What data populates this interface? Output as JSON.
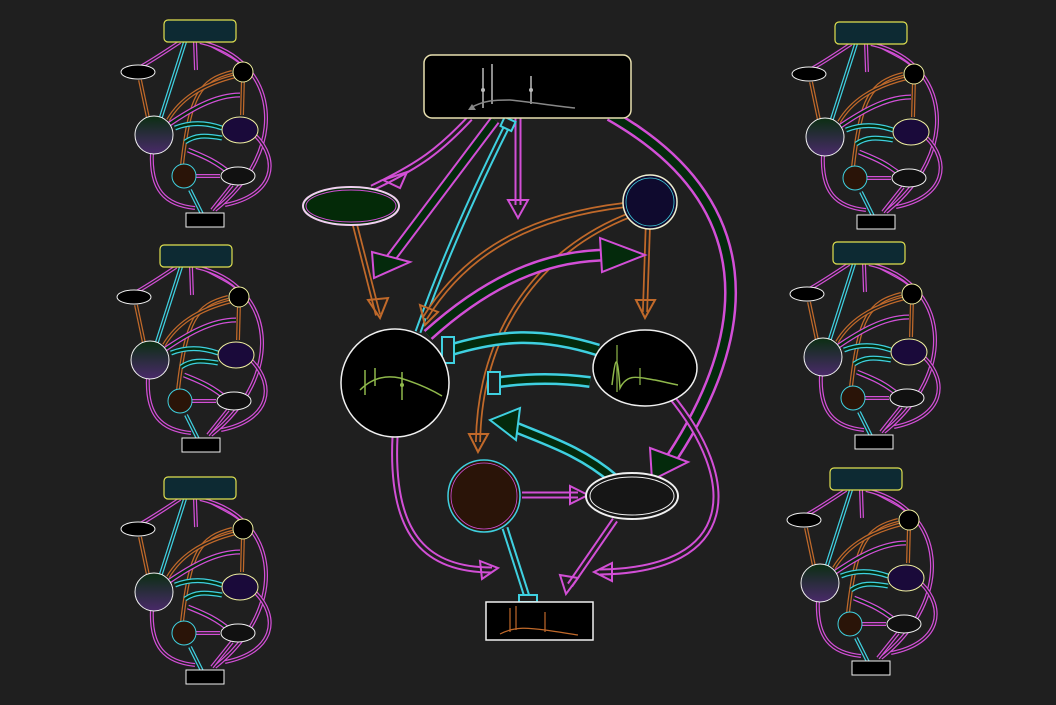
{
  "palette": {
    "background": "#1f1f1f",
    "magenta": "#d24fd6",
    "cyan": "#3fd0e0",
    "orange": "#c0692a",
    "dark_green": "#042a0c",
    "header_fill": "#0d2a33",
    "header_stroke": "#e0e050",
    "node_purple": "#1a0a3a",
    "node_brown": "#2a1408",
    "node_gray": "#151515",
    "plot_curve": "#8fb84b"
  },
  "main_diagram": {
    "nodes": [
      {
        "id": "top-plot-box",
        "kind": "rect-plot"
      },
      {
        "id": "pink-ellipse",
        "kind": "ellipse"
      },
      {
        "id": "navy-circle",
        "kind": "circle"
      },
      {
        "id": "left-plot-circle",
        "kind": "circle-plot"
      },
      {
        "id": "right-plot-circle",
        "kind": "circle-plot"
      },
      {
        "id": "brown-circle",
        "kind": "circle"
      },
      {
        "id": "gray-ellipse",
        "kind": "ellipse"
      },
      {
        "id": "bottom-plot-box",
        "kind": "rect-plot"
      }
    ]
  },
  "mini_diagrams": [
    {
      "id": "mini-top-left"
    },
    {
      "id": "mini-mid-left"
    },
    {
      "id": "mini-bottom-left"
    },
    {
      "id": "mini-top-right"
    },
    {
      "id": "mini-mid-right"
    },
    {
      "id": "mini-bottom-right"
    }
  ]
}
